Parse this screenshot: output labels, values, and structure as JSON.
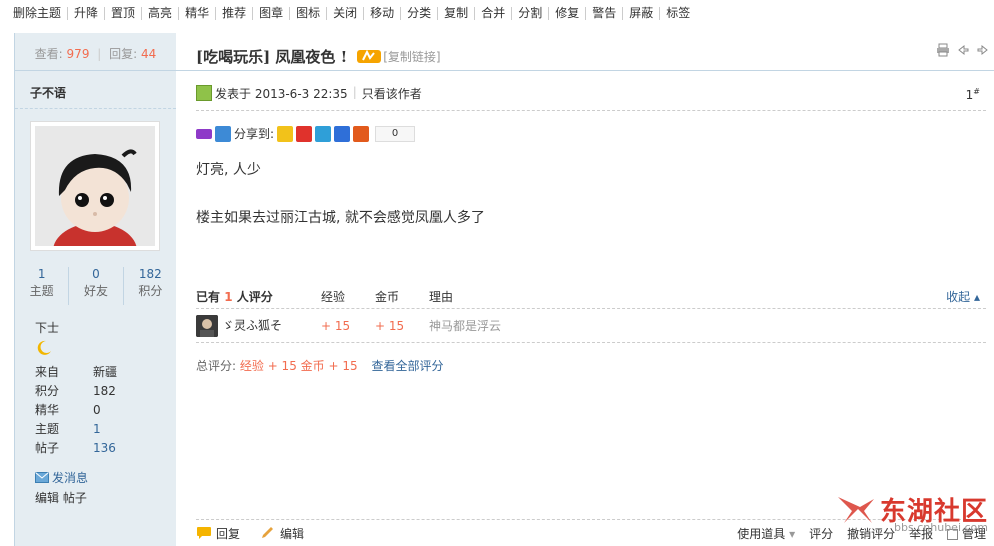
{
  "modbar": [
    "删除主题",
    "升降",
    "置顶",
    "高亮",
    "精华",
    "推荐",
    "图章",
    "图标",
    "关闭",
    "移动",
    "分类",
    "复制",
    "合并",
    "分割",
    "修复",
    "警告",
    "屏蔽",
    "标签"
  ],
  "sidebar": {
    "views_label": "查看:",
    "views": "979",
    "replies_label": "回复:",
    "replies": "44",
    "username": "子不语",
    "stats": [
      {
        "num": "1",
        "label": "主题"
      },
      {
        "num": "0",
        "label": "好友"
      },
      {
        "num": "182",
        "label": "积分"
      }
    ],
    "rank": "下士",
    "info": [
      {
        "k": "来自",
        "v": "新疆",
        "link": false
      },
      {
        "k": "积分",
        "v": "182",
        "link": false
      },
      {
        "k": "精华",
        "v": "0",
        "link": false
      },
      {
        "k": "主题",
        "v": "1",
        "link": true
      },
      {
        "k": "帖子",
        "v": "136",
        "link": true
      }
    ],
    "send_msg": "发消息",
    "edit_post": "编辑 帖子"
  },
  "post": {
    "title": "[吃喝玩乐] 凤凰夜色 !",
    "copy_link": "[复制链接]",
    "posted": "发表于 2013-6-3 22:35",
    "only_author": "只看该作者",
    "floor": "1",
    "floor_sup": "#",
    "share_label": "分享到:",
    "share_count": "0",
    "content": [
      "灯亮, 人少",
      "楼主如果去过丽江古城, 就不会感觉凤凰人多了"
    ]
  },
  "rating": {
    "hdr_prefix": "已有",
    "hdr_count": "1",
    "hdr_suffix": "人评分",
    "col_exp": "经验",
    "col_gold": "金币",
    "col_reason": "理由",
    "fold": "收起",
    "rows": [
      {
        "user": "ゞ灵ふ狐そ",
        "exp": "+ 15",
        "gold": "+ 15",
        "reason": "神马都是浮云"
      }
    ],
    "total_label": "总评分:",
    "total_exp": "经验 + 15",
    "total_gold": "金币 + 15",
    "view_all": "查看全部评分"
  },
  "bottom": {
    "reply": "回复",
    "edit": "编辑",
    "tools": "使用道具",
    "rate": "评分",
    "cancel_rate": "撤销评分",
    "report": "举报",
    "manage": "管理"
  },
  "watermark": {
    "text": "东湖社区",
    "url": "bbs.cnhubei.com"
  },
  "colors": {
    "accent": "#f26c4f",
    "link": "#336699",
    "sidebar_bg": "#e5edf2"
  }
}
